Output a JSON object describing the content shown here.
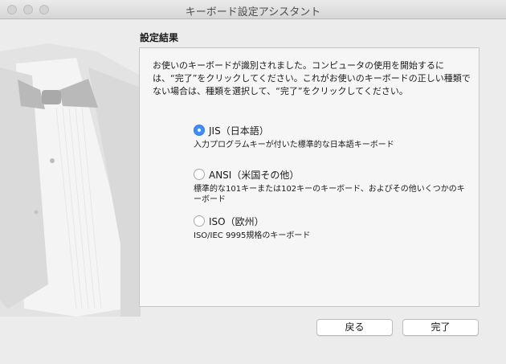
{
  "window": {
    "title": "キーボード設定アシスタント"
  },
  "section_title": "設定結果",
  "description": "お使いのキーボードが識別されました。コンピュータの使用を開始するには、“完了”をクリックしてください。これがお使いのキーボードの正しい種類でない場合は、種類を選択して、“完了”をクリックしてください。",
  "options": [
    {
      "label": "JIS（日本語）",
      "description": "入力プログラムキーが付いた標準的な日本語キーボード",
      "selected": true
    },
    {
      "label": "ANSI（米国その他）",
      "description": "標準的な101キーまたは102キーのキーボード、およびその他いくつかのキーボード",
      "selected": false
    },
    {
      "label": "ISO（欧州）",
      "description": "ISO/IEC 9995規格のキーボード",
      "selected": false
    }
  ],
  "buttons": {
    "back": "戻る",
    "done": "完了"
  },
  "colors": {
    "accent": "#3d8ef5",
    "window_bg": "#ececec"
  }
}
